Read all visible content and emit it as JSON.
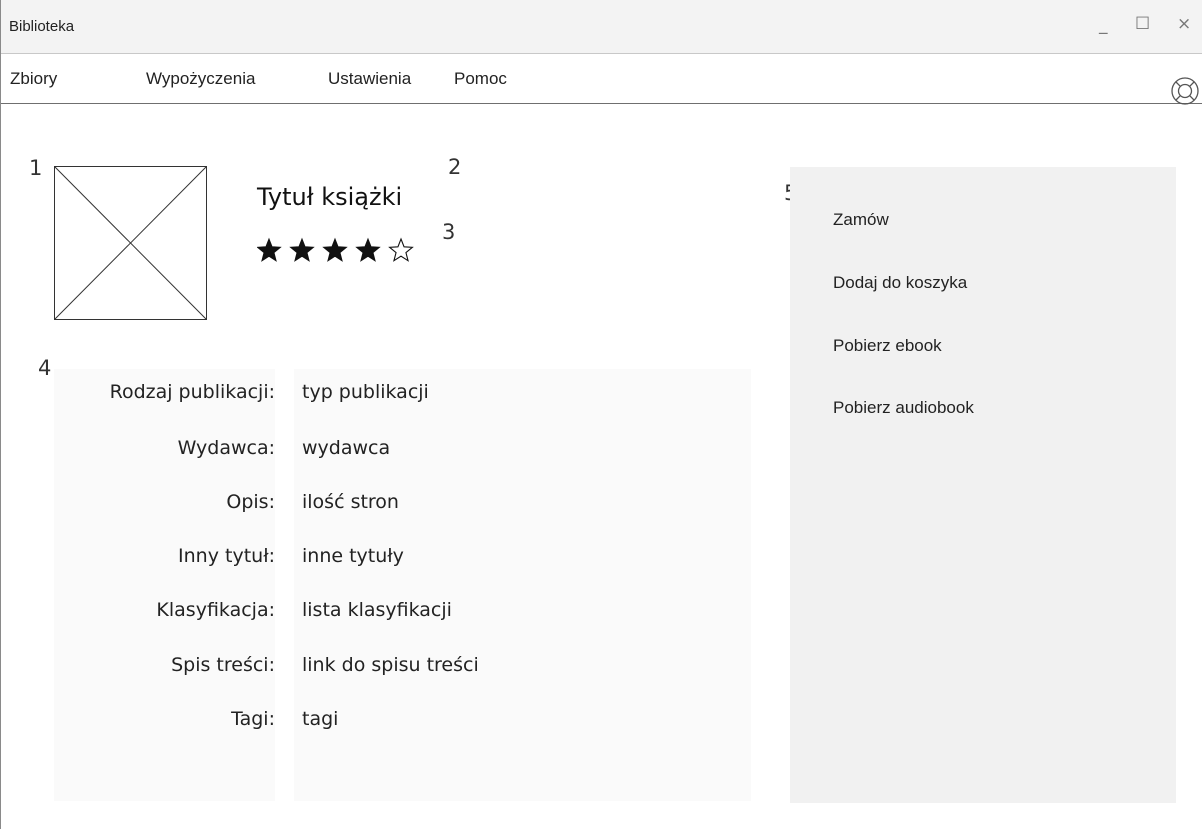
{
  "window": {
    "title": "Biblioteka",
    "controls": {
      "minimize": "_",
      "maximize": "☐",
      "close": "×"
    }
  },
  "menu": {
    "items": [
      {
        "label": "Zbiory"
      },
      {
        "label": "Wypożyczenia"
      },
      {
        "label": "Ustawienia"
      },
      {
        "label": "Pomoc"
      }
    ],
    "help_icon": "lifebuoy-icon"
  },
  "markers": {
    "cover": "1",
    "title": "2",
    "rating": "3",
    "details": "4",
    "actions": "5"
  },
  "book": {
    "title": "Tytuł książki",
    "cover_icon": "image-placeholder-icon",
    "rating": {
      "value": 4,
      "max": 5
    }
  },
  "details": [
    {
      "label": "Rodzaj publikacji:",
      "value": "typ publikacji"
    },
    {
      "label": "Wydawca:",
      "value": "wydawca"
    },
    {
      "label": "Opis:",
      "value": "ilość stron"
    },
    {
      "label": "Inny tytuł:",
      "value": "inne tytuły"
    },
    {
      "label": "Klasyfikacja:",
      "value": "lista klasyfikacji"
    },
    {
      "label": "Spis treści:",
      "value": "link do spisu treści"
    },
    {
      "label": "Tagi:",
      "value": "tagi"
    }
  ],
  "actions": [
    {
      "label": "Zamów"
    },
    {
      "label": "Dodaj do koszyka"
    },
    {
      "label": "Pobierz ebook"
    },
    {
      "label": "Pobierz audiobook"
    }
  ]
}
